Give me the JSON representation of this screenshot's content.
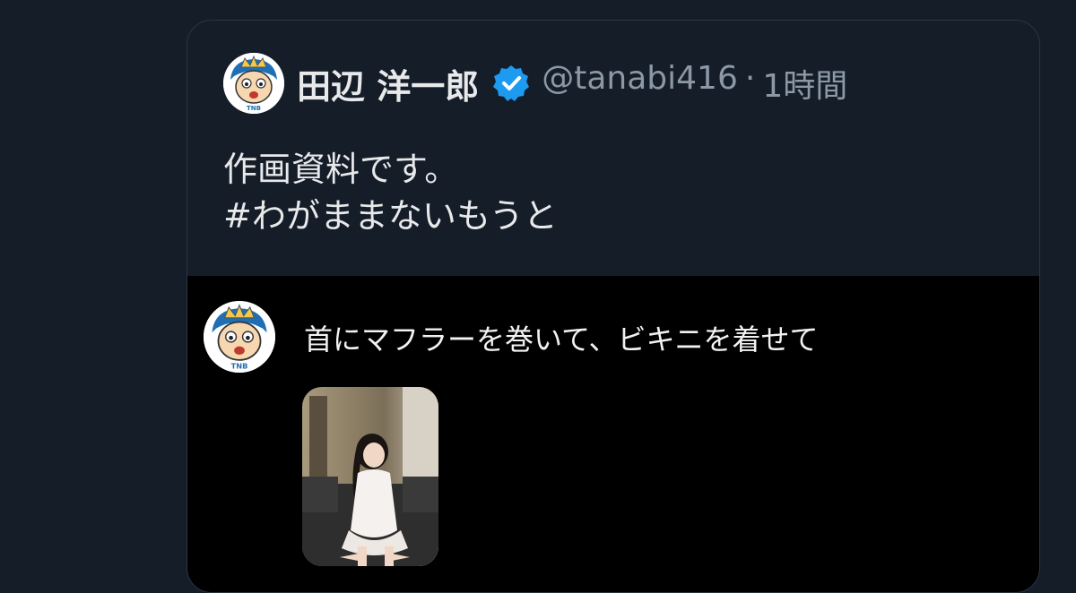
{
  "quote": {
    "author_name": "田辺 洋一郎",
    "handle": "@tanabi416",
    "separator": "·",
    "time": "1時間",
    "text": "作画資料です。\n#わがままないもうと",
    "avatar_badge": "TNB"
  },
  "media": {
    "caption": "首にマフラーを巻いて、ビキニを着せて"
  },
  "icons": {
    "verified": "verified-badge-icon",
    "verified_color": "#1d9bf0"
  },
  "colors": {
    "background": "#151d28",
    "text": "#e7e9ea",
    "muted": "#8b98a5",
    "media_bg": "#000000"
  }
}
